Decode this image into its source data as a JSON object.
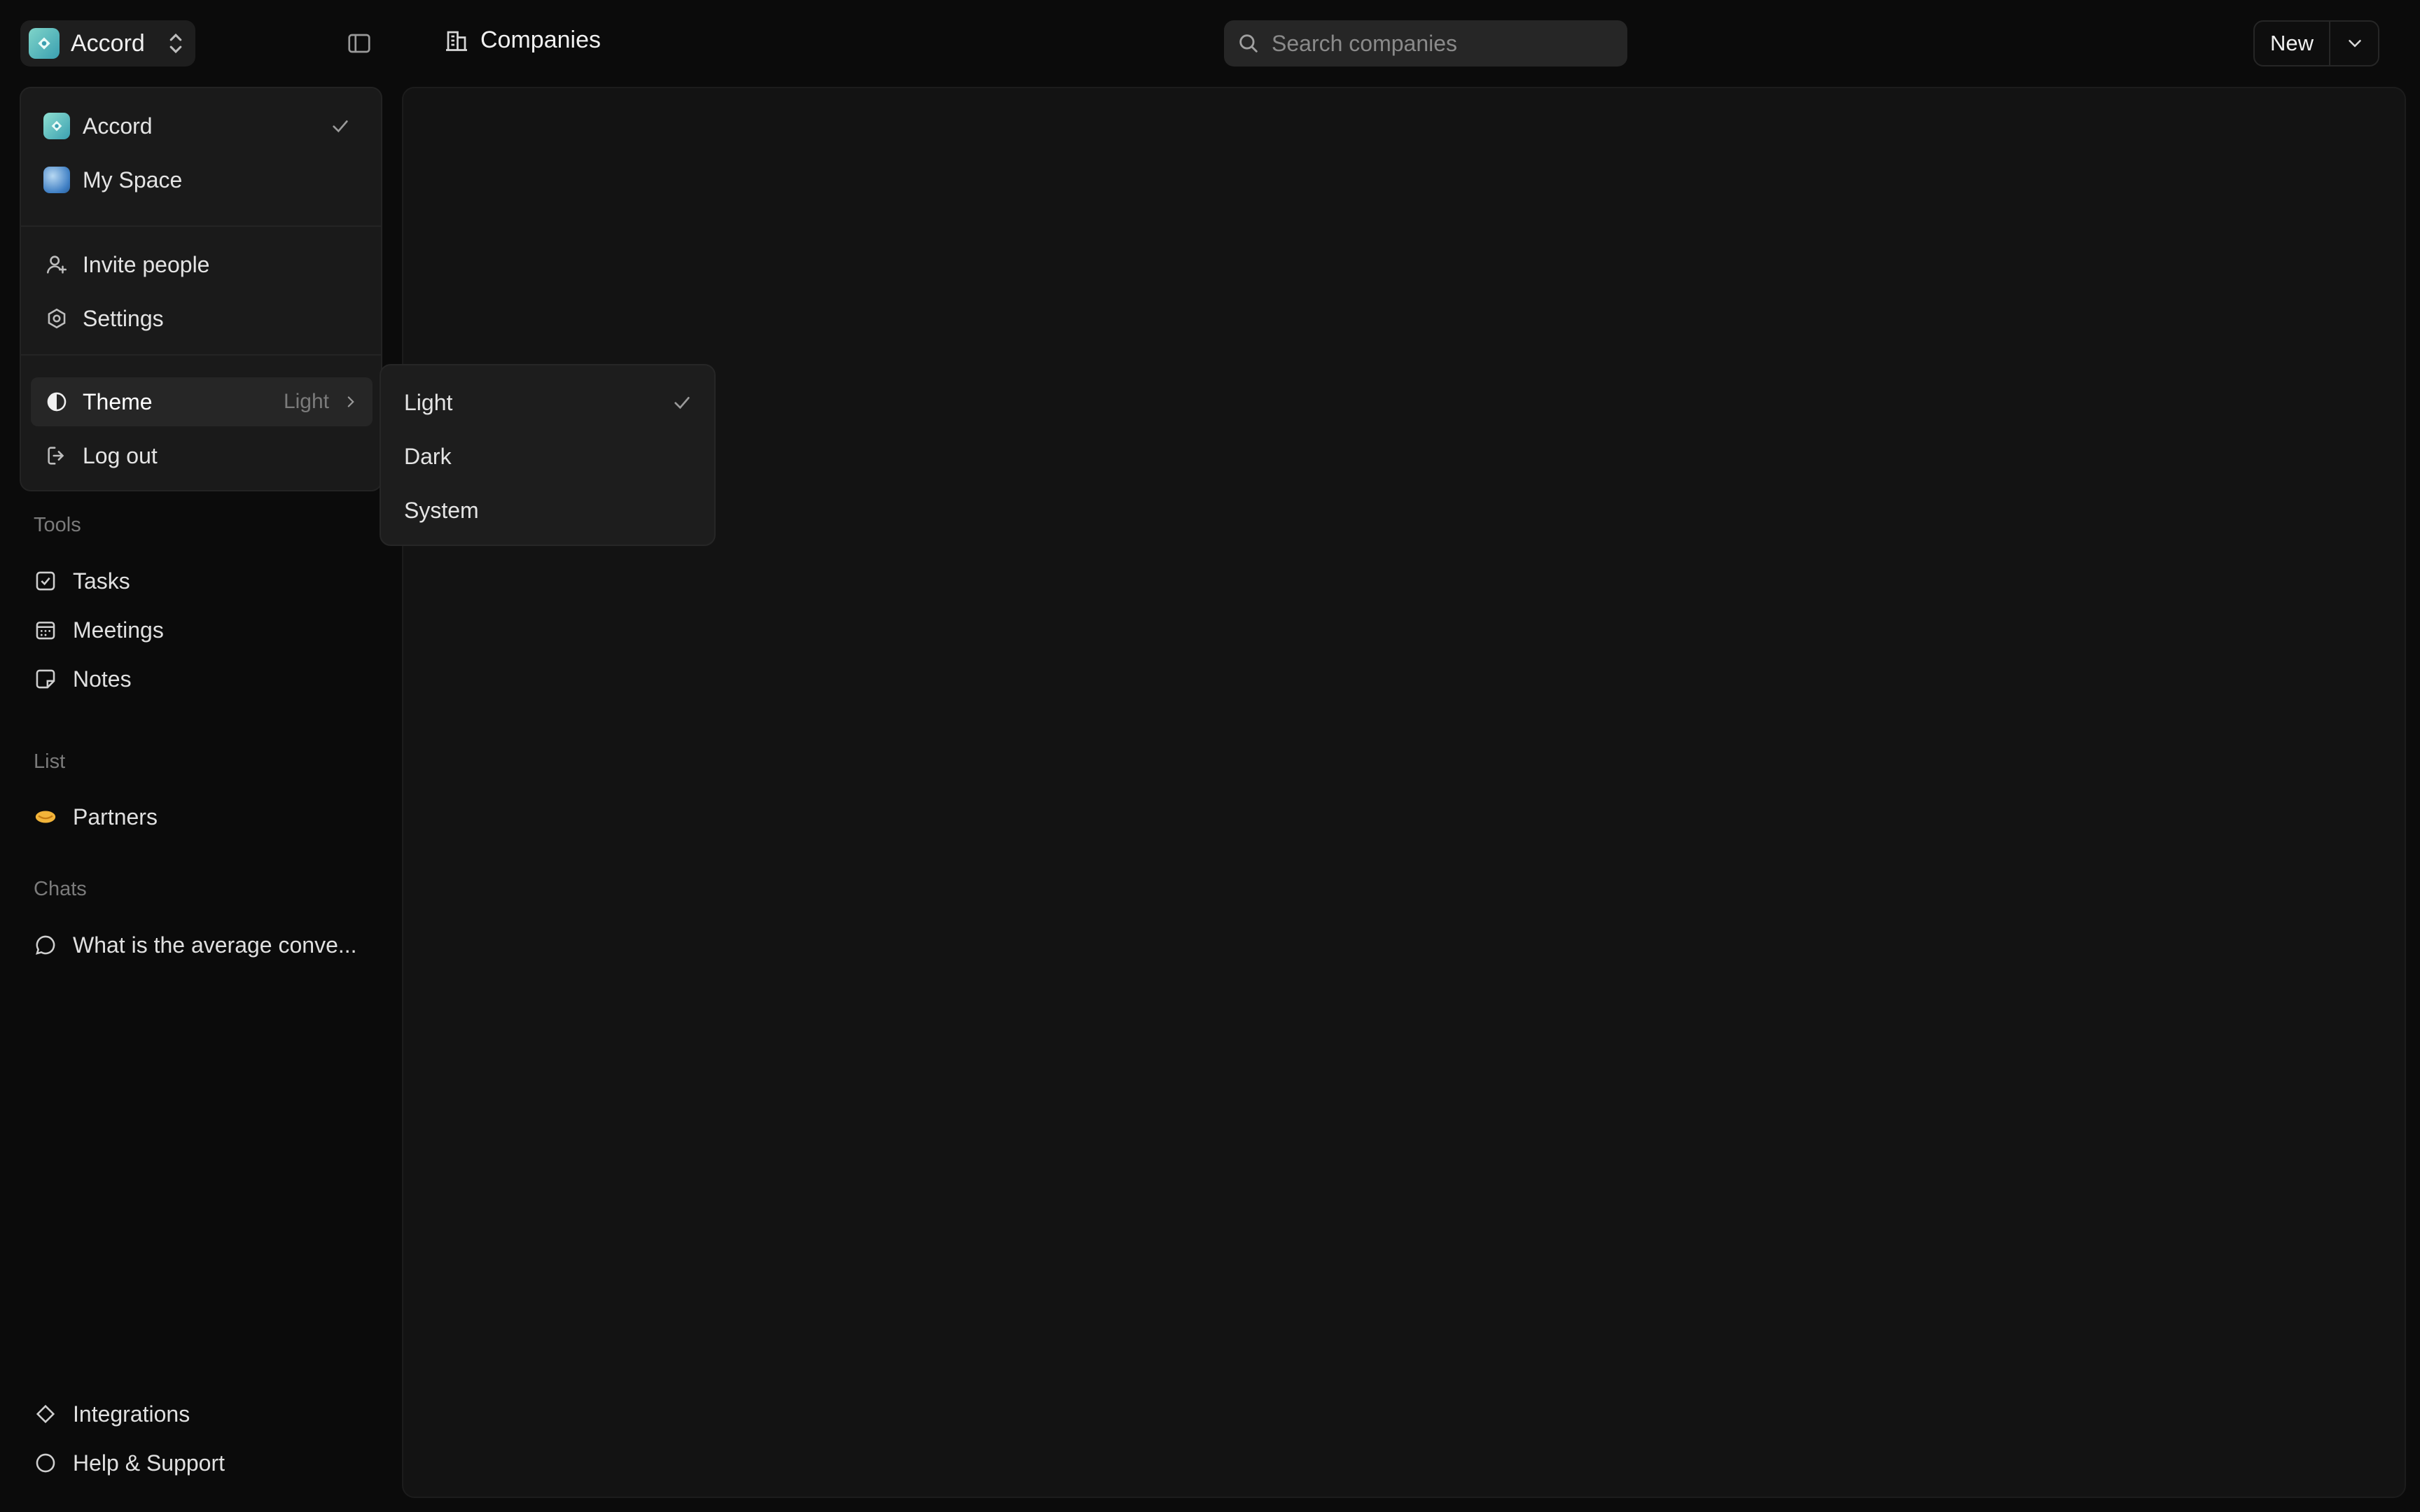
{
  "workspace": {
    "name": "Accord"
  },
  "header": {
    "breadcrumb": "Companies",
    "new_label": "New"
  },
  "search": {
    "placeholder": "Search companies"
  },
  "menu": {
    "workspaces": [
      {
        "label": "Accord",
        "selected": true
      },
      {
        "label": "My Space",
        "selected": false
      }
    ],
    "invite": "Invite people",
    "settings": "Settings",
    "theme": {
      "label": "Theme",
      "value": "Light"
    },
    "logout": "Log out"
  },
  "theme_submenu": {
    "options": [
      {
        "label": "Light",
        "selected": true
      },
      {
        "label": "Dark",
        "selected": false
      },
      {
        "label": "System",
        "selected": false
      }
    ]
  },
  "sidebar": {
    "tools_heading": "Tools",
    "tools": [
      {
        "label": "Tasks",
        "icon": "checkbox-icon"
      },
      {
        "label": "Meetings",
        "icon": "calendar-icon"
      },
      {
        "label": "Notes",
        "icon": "note-icon"
      }
    ],
    "list_heading": "List",
    "lists": [
      {
        "label": "Partners",
        "icon": "handshake-emoji"
      }
    ],
    "chats_heading": "Chats",
    "chats": [
      {
        "label": "What is the average conve..."
      }
    ],
    "footer": [
      {
        "label": "Integrations",
        "icon": "diamond-icon"
      },
      {
        "label": "Help & Support",
        "icon": "help-circle-icon"
      }
    ]
  }
}
